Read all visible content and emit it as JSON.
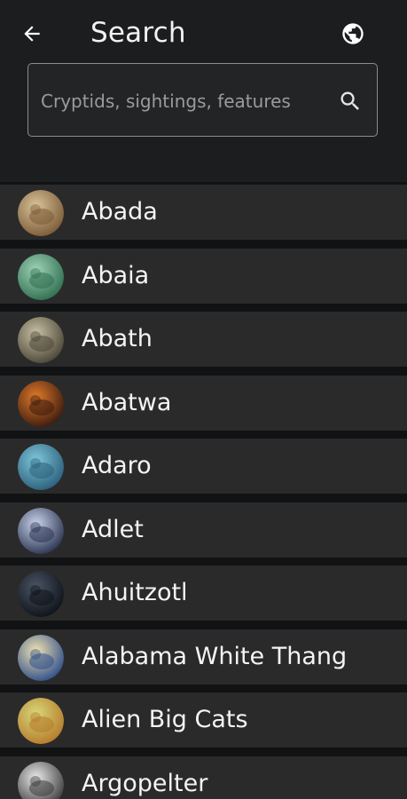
{
  "header": {
    "title": "Search",
    "back_icon": "arrow-left-icon",
    "globe_icon": "globe-icon"
  },
  "search": {
    "placeholder": "Cryptids, sightings, features",
    "value": "",
    "icon": "search-icon"
  },
  "colors": {
    "header_bg": "#1c1d1f",
    "page_bg": "#111214",
    "row_bg": "#2a2a2b",
    "text": "#f4f4f4"
  },
  "cryptids": [
    {
      "name": "Abada",
      "thumb_colors": [
        "#d9c39a",
        "#7a5a36"
      ]
    },
    {
      "name": "Abaia",
      "thumb_colors": [
        "#9fd3b8",
        "#2f6e4f"
      ]
    },
    {
      "name": "Abath",
      "thumb_colors": [
        "#c8c0a4",
        "#4a4536"
      ]
    },
    {
      "name": "Abatwa",
      "thumb_colors": [
        "#e07a2a",
        "#3a1a0e"
      ]
    },
    {
      "name": "Adaro",
      "thumb_colors": [
        "#7fc7d9",
        "#2a5e7a"
      ]
    },
    {
      "name": "Adlet",
      "thumb_colors": [
        "#c9d4ea",
        "#2a3350"
      ]
    },
    {
      "name": "Ahuitzotl",
      "thumb_colors": [
        "#4a5564",
        "#0e1218"
      ]
    },
    {
      "name": "Alabama White Thang",
      "thumb_colors": [
        "#f0e2b0",
        "#2e4e8a"
      ]
    },
    {
      "name": "Alien Big Cats",
      "thumb_colors": [
        "#d8d87a",
        "#b57a2a"
      ]
    },
    {
      "name": "Argopelter",
      "thumb_colors": [
        "#eaeaea",
        "#3a3a3a"
      ]
    }
  ]
}
